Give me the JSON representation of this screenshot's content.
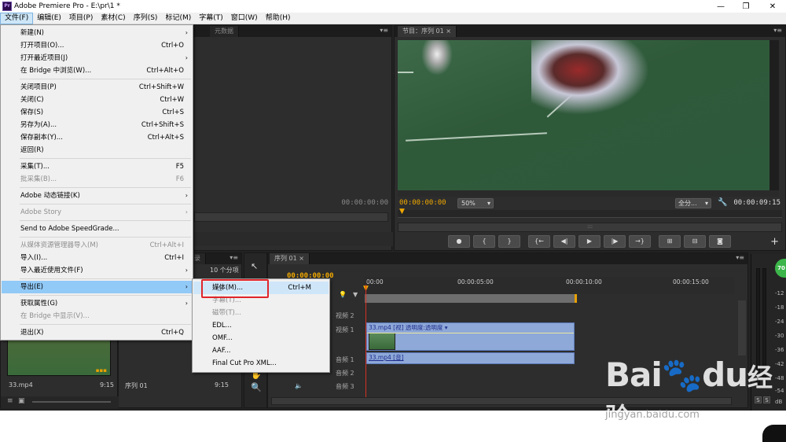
{
  "window": {
    "title": "Adobe Premiere Pro - E:\\pr\\1 *",
    "app_icon": "Pr",
    "minimize": "—",
    "maximize": "❐",
    "close": "✕"
  },
  "menubar": [
    {
      "label": "文件(F)",
      "active": true
    },
    {
      "label": "编辑(E)"
    },
    {
      "label": "项目(P)"
    },
    {
      "label": "素材(C)"
    },
    {
      "label": "序列(S)"
    },
    {
      "label": "标记(M)"
    },
    {
      "label": "字幕(T)"
    },
    {
      "label": "窗口(W)"
    },
    {
      "label": "帮助(H)"
    }
  ],
  "file_menu": [
    {
      "label": "新建(N)",
      "shortcut": "",
      "submenu": true
    },
    {
      "label": "打开项目(O)...",
      "shortcut": "Ctrl+O"
    },
    {
      "label": "打开最近项目(J)",
      "shortcut": "",
      "submenu": true
    },
    {
      "label": "在 Bridge 中浏览(W)...",
      "shortcut": "Ctrl+Alt+O"
    },
    {
      "sep": true
    },
    {
      "label": "关闭项目(P)",
      "shortcut": "Ctrl+Shift+W"
    },
    {
      "label": "关闭(C)",
      "shortcut": "Ctrl+W"
    },
    {
      "label": "保存(S)",
      "shortcut": "Ctrl+S"
    },
    {
      "label": "另存为(A)...",
      "shortcut": "Ctrl+Shift+S"
    },
    {
      "label": "保存副本(Y)...",
      "shortcut": "Ctrl+Alt+S"
    },
    {
      "label": "返回(R)",
      "shortcut": ""
    },
    {
      "sep": true
    },
    {
      "label": "采集(T)...",
      "shortcut": "F5"
    },
    {
      "label": "批采集(B)...",
      "shortcut": "F6",
      "disabled": true
    },
    {
      "sep": true
    },
    {
      "label": "Adobe 动态链接(K)",
      "shortcut": "",
      "submenu": true
    },
    {
      "sep": true
    },
    {
      "label": "Adobe Story",
      "shortcut": "",
      "submenu": true,
      "disabled": true
    },
    {
      "sep": true
    },
    {
      "label": "Send to Adobe SpeedGrade...",
      "shortcut": ""
    },
    {
      "sep": true
    },
    {
      "label": "从媒体资源管理器导入(M)",
      "shortcut": "Ctrl+Alt+I",
      "disabled": true
    },
    {
      "label": "导入(I)...",
      "shortcut": "Ctrl+I"
    },
    {
      "label": "导入最近使用文件(F)",
      "shortcut": "",
      "submenu": true
    },
    {
      "sep": true
    },
    {
      "label": "导出(E)",
      "shortcut": "",
      "submenu": true,
      "highlighted": true
    },
    {
      "sep": true
    },
    {
      "label": "获取属性(G)",
      "shortcut": "",
      "submenu": true
    },
    {
      "label": "在 Bridge 中显示(V)...",
      "shortcut": "",
      "disabled": true
    },
    {
      "sep": true
    },
    {
      "label": "退出(X)",
      "shortcut": "Ctrl+Q"
    }
  ],
  "export_submenu": [
    {
      "label": "媒体(M)...",
      "shortcut": "Ctrl+M",
      "highlighted": true
    },
    {
      "label": "字幕(T)...",
      "disabled": true
    },
    {
      "label": "磁带(T)...",
      "disabled": true
    },
    {
      "label": "EDL..."
    },
    {
      "label": "OMF..."
    },
    {
      "label": "AAF..."
    },
    {
      "label": "Final Cut Pro XML..."
    }
  ],
  "source_panel": {
    "tab_metadata": "元数据",
    "timecode": "00:00:00:00"
  },
  "program_monitor": {
    "tab": "节目：序列 01",
    "timecode_current": "00:00:00:00",
    "zoom": "50%",
    "quality": "全分...",
    "timecode_duration": "00:00:09:15"
  },
  "project_panel": {
    "tab_suffix": "录",
    "items_count": "10 个分项",
    "thumb1_name": "33.mp4",
    "thumb1_duration": "9:15",
    "thumb2_name": "序列 01",
    "thumb2_duration": "9:15"
  },
  "timeline": {
    "tab": "序列 01",
    "timecode": "00:00:00:00",
    "ruler": [
      "00:00",
      "00:00:05:00",
      "00:00:10:00",
      "00:00:15:00"
    ],
    "tracks": {
      "video2": "视频 2",
      "video1": "视频 1",
      "audio1": "音频 1",
      "audio2": "音频 2",
      "audio3": "音频 3"
    },
    "video_clip": "33.mp4 [视]  透明度:透明度 ▾",
    "audio_clip": "33.mp4 [音]"
  },
  "vu_meter": {
    "labels": [
      "-12",
      "-18",
      "-24",
      "-30",
      "-36",
      "-42",
      "-48",
      "-54",
      "dB"
    ],
    "badge": "70",
    "solo": "S"
  },
  "watermark": {
    "brand": "Bai",
    "brand2": "du",
    "cn": "经验",
    "url": "jingyan.baidu.com"
  },
  "colors": {
    "accent_timecode": "#f0a800",
    "menu_highlight": "#91c9f7",
    "annotation_red": "#e0242b",
    "clip_blue": "#8ea8d8"
  }
}
